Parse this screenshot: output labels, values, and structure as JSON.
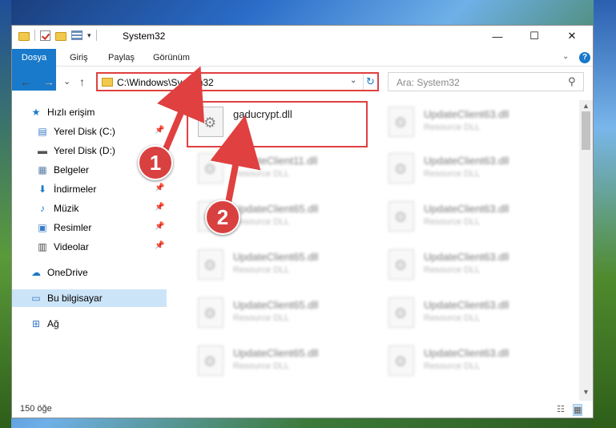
{
  "window": {
    "title": "System32",
    "minimize": "—",
    "maximize": "☐",
    "close": "✕"
  },
  "ribbon": {
    "tabs": [
      "Dosya",
      "Giriş",
      "Paylaş",
      "Görünüm"
    ]
  },
  "navigation": {
    "back": "←",
    "forward": "→",
    "recent": "⌄",
    "up": "↑",
    "address": "C:\\Windows\\System32",
    "search_placeholder": "Ara: System32"
  },
  "sidebar": {
    "items": [
      {
        "label": "Hızlı erişim",
        "icon": "★"
      },
      {
        "label": "Yerel Disk (C:)",
        "icon": "▤"
      },
      {
        "label": "Yerel Disk (D:)",
        "icon": "▬"
      },
      {
        "label": "Belgeler",
        "icon": "▦"
      },
      {
        "label": "İndirmeler",
        "icon": "⬇"
      },
      {
        "label": "Müzik",
        "icon": "♪"
      },
      {
        "label": "Resimler",
        "icon": "▣"
      },
      {
        "label": "Videolar",
        "icon": "▥"
      },
      {
        "label": "OneDrive",
        "icon": "☁"
      },
      {
        "label": "Bu bilgisayar",
        "icon": "▭"
      },
      {
        "label": "Ağ",
        "icon": "⊞"
      }
    ]
  },
  "files": [
    {
      "name": "gaducrypt.dll",
      "type": ""
    },
    {
      "name": "UpdateClient63.dll",
      "type": "Resource DLL"
    },
    {
      "name": "UpdateClient11.dll",
      "type": "Resource DLL"
    },
    {
      "name": "UpdateClient63.dll",
      "type": "Resource DLL"
    },
    {
      "name": "UpdateClient65.dll",
      "type": "Resource DLL"
    },
    {
      "name": "UpdateClient63.dll",
      "type": "Resource DLL"
    },
    {
      "name": "UpdateClient65.dll",
      "type": "Resource DLL"
    },
    {
      "name": "UpdateClient63.dll",
      "type": "Resource DLL"
    },
    {
      "name": "UpdateClient65.dll",
      "type": "Resource DLL"
    },
    {
      "name": "UpdateClient63.dll",
      "type": "Resource DLL"
    },
    {
      "name": "UpdateClient65.dll",
      "type": "Resource DLL"
    },
    {
      "name": "UpdateClient63.dll",
      "type": "Resource DLL"
    }
  ],
  "status": {
    "item_count": "150 öğe"
  },
  "callouts": [
    "1",
    "2"
  ],
  "colors": {
    "accent": "#1979ca",
    "highlight": "#e04040",
    "selection": "#cce4f7"
  }
}
